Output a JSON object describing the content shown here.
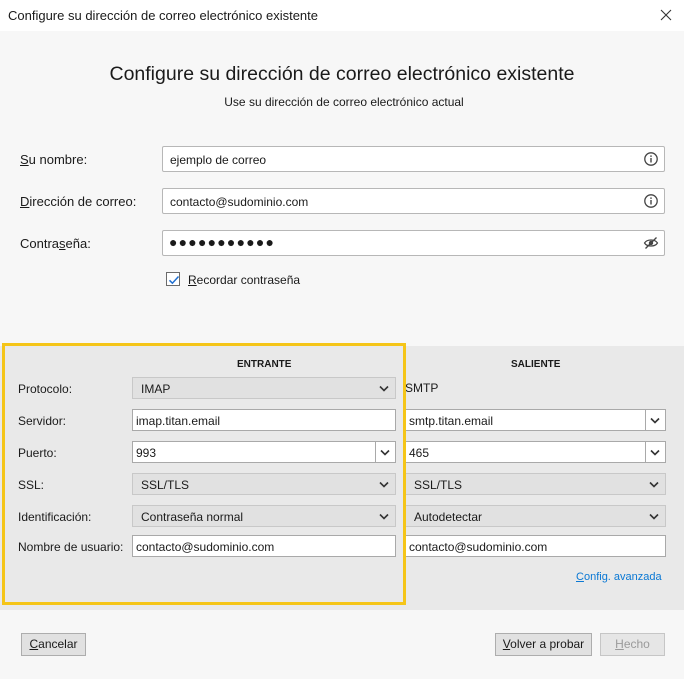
{
  "window": {
    "title": "Configure su dirección de correo electrónico existente"
  },
  "header": {
    "title": "Configure su dirección de correo electrónico existente",
    "subtitle": "Use su dirección de correo electrónico actual"
  },
  "form": {
    "name": {
      "label_key": "S",
      "label_rest": "u nombre:",
      "value": "ejemplo de correo"
    },
    "email": {
      "label_key": "D",
      "label_rest": "irección de correo:",
      "value": "contacto@sudominio.com"
    },
    "password": {
      "label_pre": "Contra",
      "label_key": "s",
      "label_rest": "eña:",
      "value": "●●●●●●●●●●●"
    },
    "remember": {
      "label_key": "R",
      "label_rest": "ecordar contraseña",
      "checked": true
    }
  },
  "server": {
    "incoming_header": "ENTRANTE",
    "outgoing_header": "SALIENTE",
    "labels": {
      "protocol": "Protocolo:",
      "server": "Servidor:",
      "port": "Puerto:",
      "ssl": "SSL:",
      "auth": "Identificación:",
      "username": "Nombre de usuario:"
    },
    "incoming": {
      "protocol": "IMAP",
      "server": "imap.titan.email",
      "port": "993",
      "ssl": "SSL/TLS",
      "auth": "Contraseña normal",
      "username": "contacto@sudominio.com"
    },
    "outgoing": {
      "protocol": "SMTP",
      "server": "smtp.titan.email",
      "port": "465",
      "ssl": "SSL/TLS",
      "auth": "Autodetectar",
      "username": "contacto@sudominio.com"
    },
    "advanced_link": {
      "label_key": "C",
      "label_rest": "onfig. avanzada"
    }
  },
  "buttons": {
    "cancel": {
      "label_key": "C",
      "label_rest": "ancelar"
    },
    "retry": {
      "label_key": "V",
      "label_rest": "olver a probar"
    },
    "done": {
      "label_key": "H",
      "label_rest": "echo"
    }
  },
  "colors": {
    "highlight": "#f5c518",
    "link": "#0a78d4",
    "panel": "#e9e9e9"
  },
  "icons": [
    "close-icon",
    "info-icon",
    "eye-slash-icon",
    "checkmark-icon",
    "chevron-down-icon"
  ]
}
